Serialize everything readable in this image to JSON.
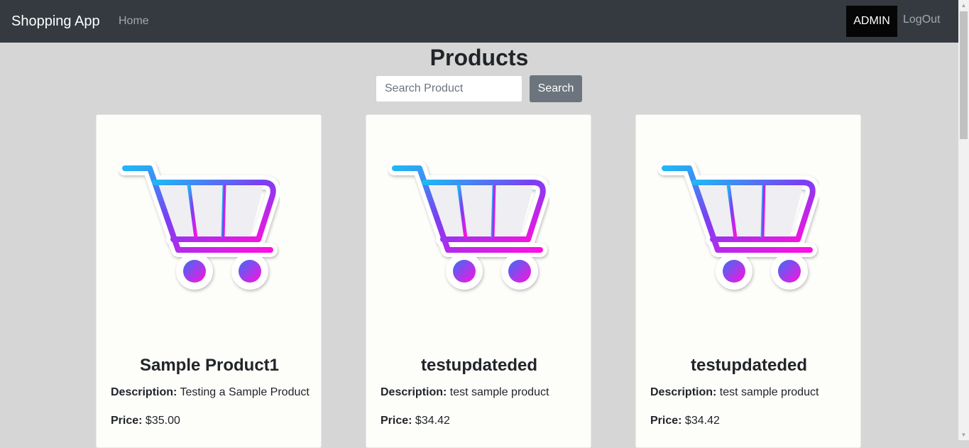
{
  "navbar": {
    "brand": "Shopping App",
    "home": "Home",
    "admin": "ADMIN",
    "logout": "LogOut"
  },
  "page": {
    "title": "Products"
  },
  "search": {
    "placeholder": "Search Product",
    "value": "",
    "button": "Search"
  },
  "labels": {
    "description": "Description:",
    "price": "Price:"
  },
  "products": [
    {
      "name": "Sample Product1",
      "description": "Testing a Sample Product",
      "price": "$35.00",
      "image_icon": "shopping-cart-icon"
    },
    {
      "name": "testupdateded",
      "description": "test sample product",
      "price": "$34.42",
      "image_icon": "shopping-cart-icon"
    },
    {
      "name": "testupdateded",
      "description": "test sample product",
      "price": "$34.42",
      "image_icon": "shopping-cart-icon"
    }
  ],
  "colors": {
    "navbar_bg": "#343a40",
    "page_bg": "#d6d6d6",
    "search_button_bg": "#6c757d",
    "cart_gradient_start": "#1fb8f4",
    "cart_gradient_mid": "#7a3ff2",
    "cart_gradient_end": "#ff10e0"
  }
}
